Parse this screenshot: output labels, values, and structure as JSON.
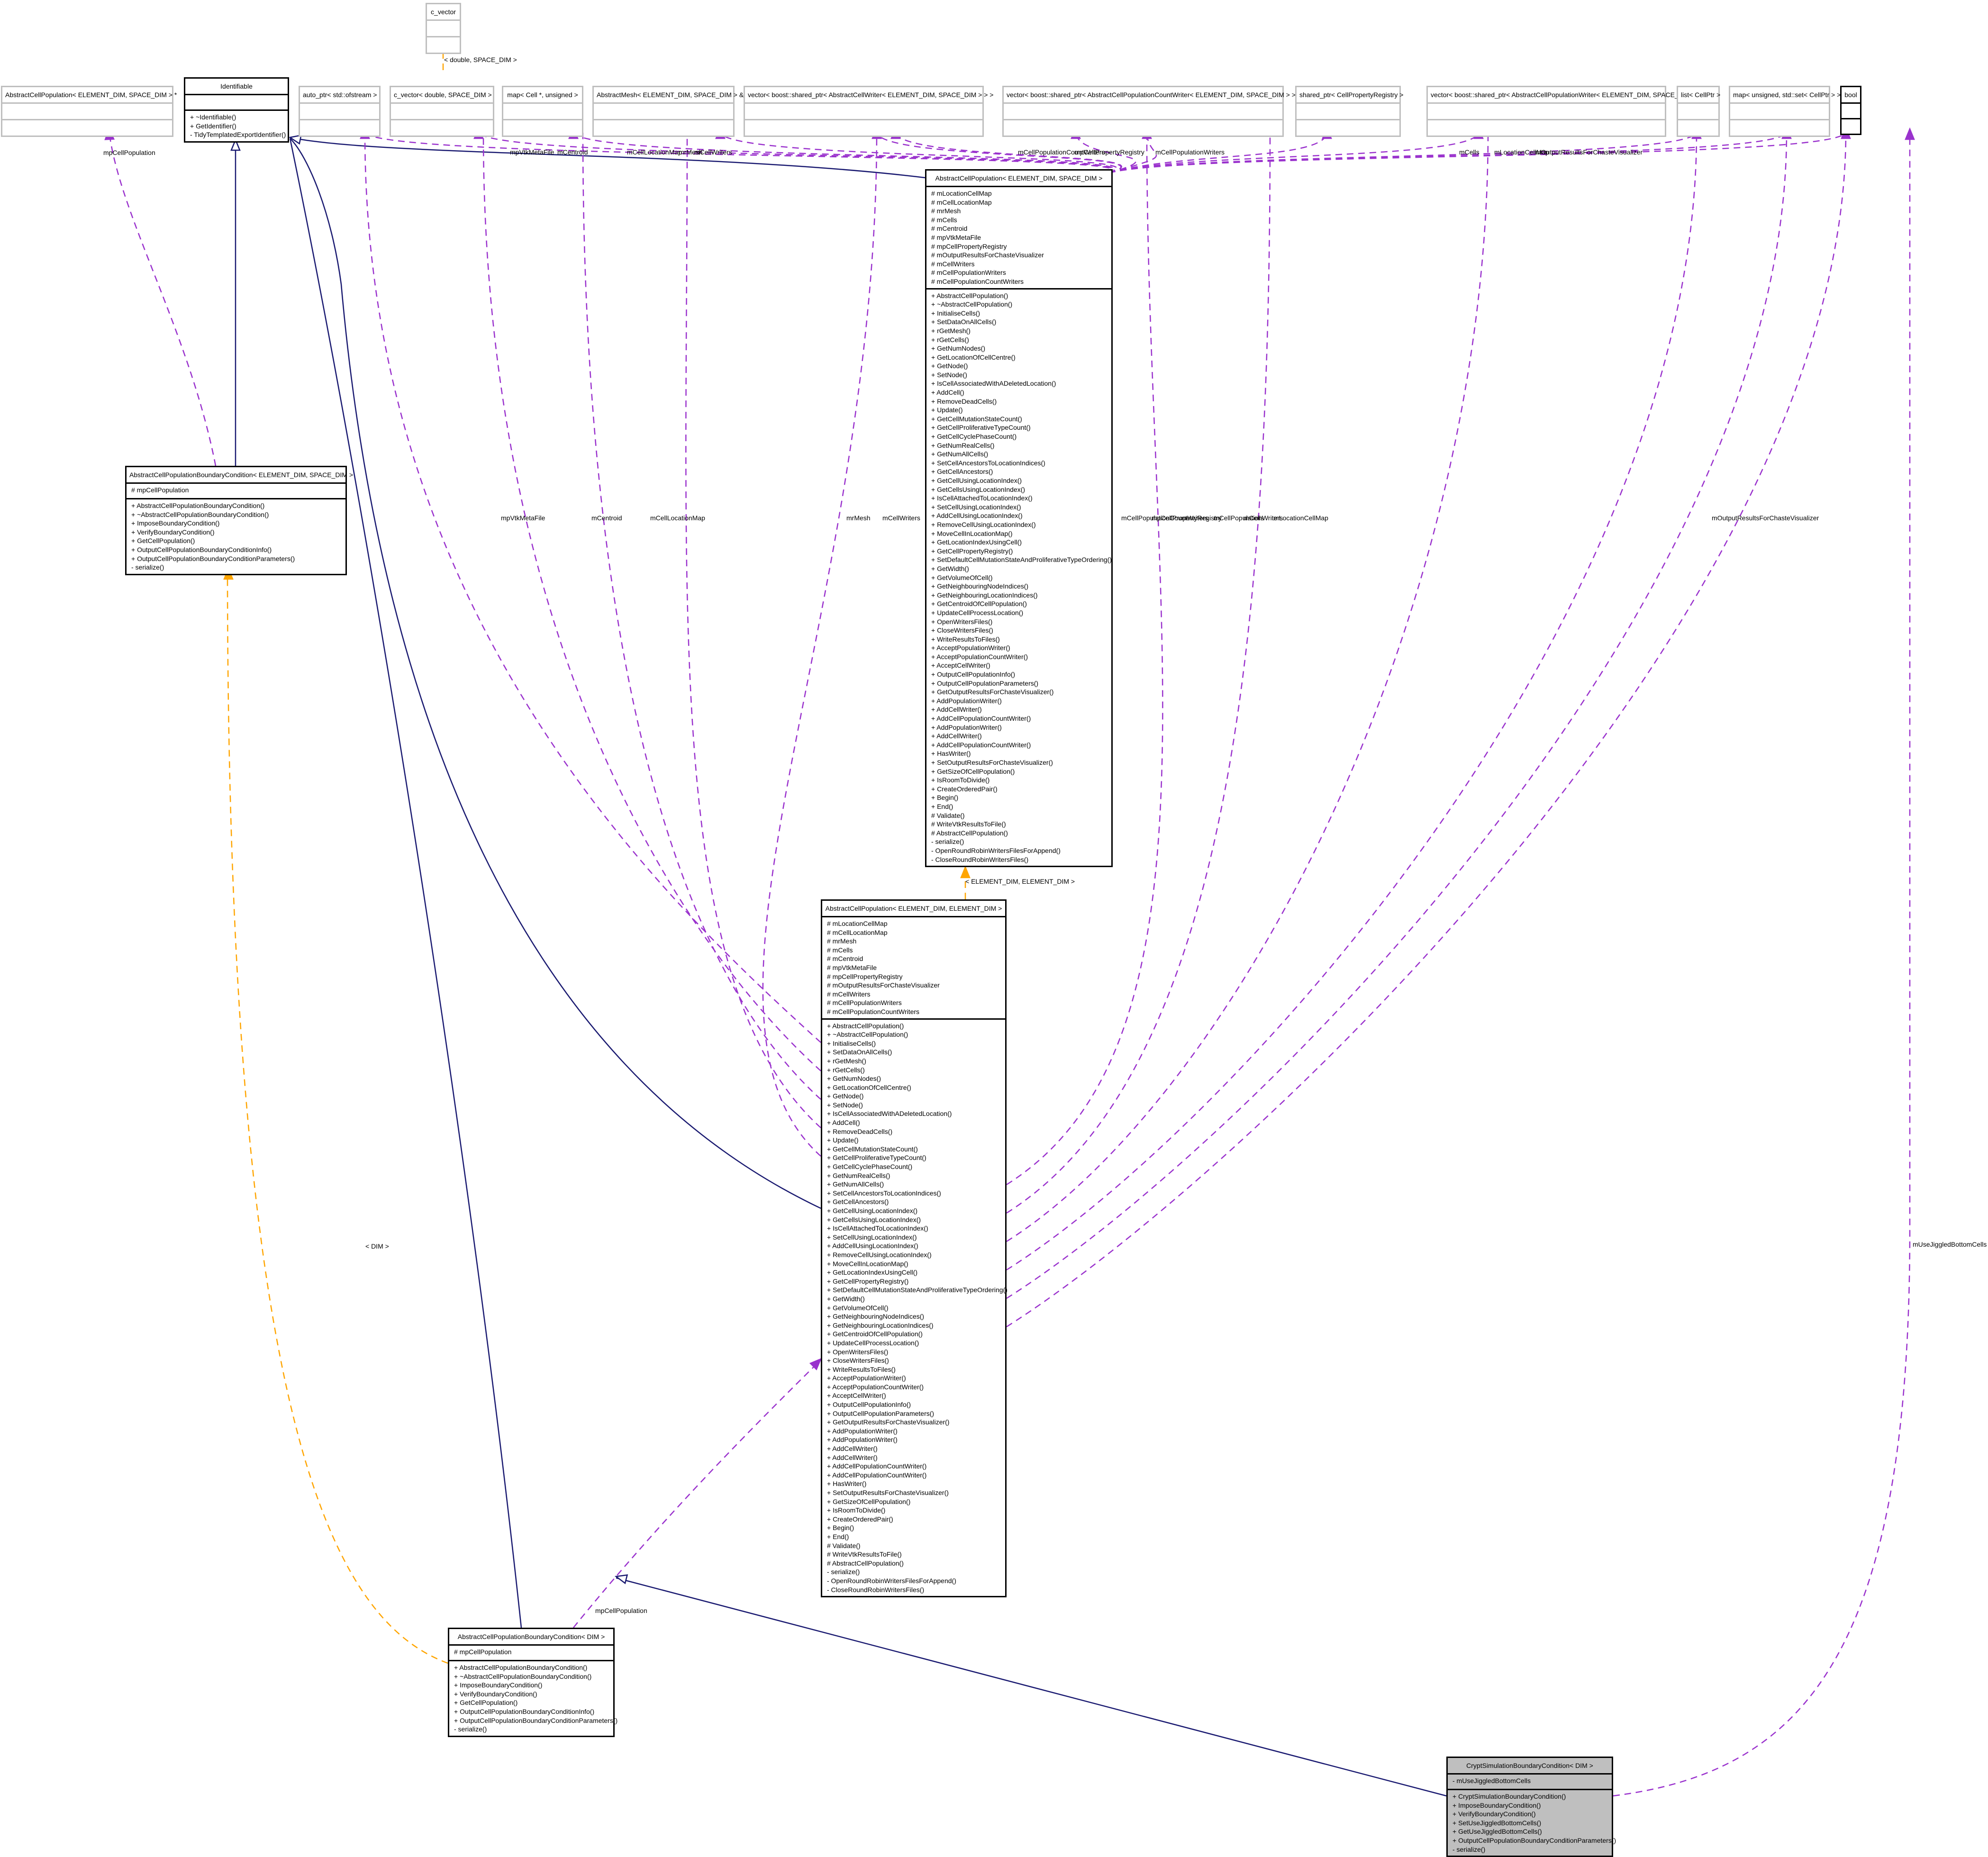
{
  "colors": {
    "inheritance": "#191970",
    "usage": "#9a32cd",
    "template": "#ffa500",
    "highlight_fill": "#bfbfbf",
    "placeholder_border": "#bfbfbf"
  },
  "nodes": {
    "c_vector": {
      "title": "c_vector",
      "attributes": [],
      "methods": []
    },
    "acp_ptr": {
      "title": "AbstractCellPopulation< ELEMENT_DIM, SPACE_DIM > *",
      "attributes": [],
      "methods": []
    },
    "identifiable": {
      "title": "Identifiable",
      "attributes": [],
      "methods": [
        "+ ~Identifiable()",
        "+ GetIdentifier()",
        "- TidyTemplatedExportIdentifier()"
      ]
    },
    "auto_ptr": {
      "title": "auto_ptr< std::ofstream >",
      "attributes": [],
      "methods": []
    },
    "c_vector_double": {
      "title": "c_vector< double, SPACE_DIM >",
      "attributes": [],
      "methods": []
    },
    "map_cell_unsigned": {
      "title": "map< Cell *, unsigned >",
      "attributes": [],
      "methods": []
    },
    "abstract_mesh": {
      "title": "AbstractMesh< ELEMENT_DIM, SPACE_DIM > &",
      "attributes": [],
      "methods": []
    },
    "vec_cell_writer": {
      "title": "vector< boost::shared_ptr< AbstractCellWriter< ELEMENT_DIM, SPACE_DIM > > >",
      "attributes": [],
      "methods": []
    },
    "vec_count_writer": {
      "title": "vector< boost::shared_ptr< AbstractCellPopulationCountWriter< ELEMENT_DIM, SPACE_DIM > > >",
      "attributes": [],
      "methods": []
    },
    "shared_registry": {
      "title": "shared_ptr< CellPropertyRegistry >",
      "attributes": [],
      "methods": []
    },
    "vec_pop_writer": {
      "title": "vector< boost::shared_ptr< AbstractCellPopulationWriter< ELEMENT_DIM, SPACE_DIM > > >",
      "attributes": [],
      "methods": []
    },
    "list_cellptr": {
      "title": "list< CellPtr >",
      "attributes": [],
      "methods": []
    },
    "map_unsigned_set": {
      "title": "map< unsigned, std::set< CellPtr > >",
      "attributes": [],
      "methods": []
    },
    "bool": {
      "title": "bool",
      "attributes": [],
      "methods": []
    },
    "acp_es": {
      "title": "AbstractCellPopulation< ELEMENT_DIM, SPACE_DIM >",
      "attributes": [
        "# mLocationCellMap",
        "# mCellLocationMap",
        "# mrMesh",
        "# mCells",
        "# mCentroid",
        "# mpVtkMetaFile",
        "# mpCellPropertyRegistry",
        "# mOutputResultsForChasteVisualizer",
        "# mCellWriters",
        "# mCellPopulationWriters",
        "# mCellPopulationCountWriters"
      ],
      "methods": [
        "+ AbstractCellPopulation()",
        "+ ~AbstractCellPopulation()",
        "+ InitialiseCells()",
        "+ SetDataOnAllCells()",
        "+ rGetMesh()",
        "+ rGetCells()",
        "+ GetNumNodes()",
        "+ GetLocationOfCellCentre()",
        "+ GetNode()",
        "+ SetNode()",
        "+ IsCellAssociatedWithADeletedLocation()",
        "+ AddCell()",
        "+ RemoveDeadCells()",
        "+ Update()",
        "+ GetCellMutationStateCount()",
        "+ GetCellProliferativeTypeCount()",
        "+ GetCellCyclePhaseCount()",
        "+ GetNumRealCells()",
        "+ GetNumAllCells()",
        "+ SetCellAncestorsToLocationIndices()",
        "+ GetCellAncestors()",
        "+ GetCellUsingLocationIndex()",
        "+ GetCellsUsingLocationIndex()",
        "+ IsCellAttachedToLocationIndex()",
        "+ SetCellUsingLocationIndex()",
        "+ AddCellUsingLocationIndex()",
        "+ RemoveCellUsingLocationIndex()",
        "+ MoveCellInLocationMap()",
        "+ GetLocationIndexUsingCell()",
        "+ GetCellPropertyRegistry()",
        "+ SetDefaultCellMutationStateAndProliferativeTypeOrdering()",
        "+ GetWidth()",
        "+ GetVolumeOfCell()",
        "+ GetNeighbouringNodeIndices()",
        "+ GetNeighbouringLocationIndices()",
        "+ GetCentroidOfCellPopulation()",
        "+ UpdateCellProcessLocation()",
        "+ OpenWritersFiles()",
        "+ CloseWritersFiles()",
        "+ WriteResultsToFiles()",
        "+ AcceptPopulationWriter()",
        "+ AcceptPopulationCountWriter()",
        "+ AcceptCellWriter()",
        "+ OutputCellPopulationInfo()",
        "+ OutputCellPopulationParameters()",
        "+ GetOutputResultsForChasteVisualizer()",
        "+ AddPopulationWriter()",
        "+ AddCellWriter()",
        "+ AddCellPopulationCountWriter()",
        "+ AddPopulationWriter()",
        "+ AddCellWriter()",
        "+ AddCellPopulationCountWriter()",
        "+ HasWriter()",
        "+ SetOutputResultsForChasteVisualizer()",
        "+ GetSizeOfCellPopulation()",
        "+ IsRoomToDivide()",
        "+ CreateOrderedPair()",
        "+ Begin()",
        "+ End()",
        "# Validate()",
        "# WriteVtkResultsToFile()",
        "# AbstractCellPopulation()",
        "- serialize()",
        "- OpenRoundRobinWritersFilesForAppend()",
        "- CloseRoundRobinWritersFiles()"
      ]
    },
    "acpbc_es": {
      "title": "AbstractCellPopulationBoundaryCondition< ELEMENT_DIM, SPACE_DIM >",
      "attributes": [
        "# mpCellPopulation"
      ],
      "methods": [
        "+ AbstractCellPopulationBoundaryCondition()",
        "+ ~AbstractCellPopulationBoundaryCondition()",
        "+ ImposeBoundaryCondition()",
        "+ VerifyBoundaryCondition()",
        "+ GetCellPopulation()",
        "+ OutputCellPopulationBoundaryConditionInfo()",
        "+ OutputCellPopulationBoundaryConditionParameters()",
        "- serialize()"
      ]
    },
    "acp_ee": {
      "title": "AbstractCellPopulation< ELEMENT_DIM, ELEMENT_DIM >",
      "attributes": [
        "# mLocationCellMap",
        "# mCellLocationMap",
        "# mrMesh",
        "# mCells",
        "# mCentroid",
        "# mpVtkMetaFile",
        "# mpCellPropertyRegistry",
        "# mOutputResultsForChasteVisualizer",
        "# mCellWriters",
        "# mCellPopulationWriters",
        "# mCellPopulationCountWriters"
      ],
      "methods": [
        "+ AbstractCellPopulation()",
        "+ ~AbstractCellPopulation()",
        "+ InitialiseCells()",
        "+ SetDataOnAllCells()",
        "+ rGetMesh()",
        "+ rGetCells()",
        "+ GetNumNodes()",
        "+ GetLocationOfCellCentre()",
        "+ GetNode()",
        "+ SetNode()",
        "+ IsCellAssociatedWithADeletedLocation()",
        "+ AddCell()",
        "+ RemoveDeadCells()",
        "+ Update()",
        "+ GetCellMutationStateCount()",
        "+ GetCellProliferativeTypeCount()",
        "+ GetCellCyclePhaseCount()",
        "+ GetNumRealCells()",
        "+ GetNumAllCells()",
        "+ SetCellAncestorsToLocationIndices()",
        "+ GetCellAncestors()",
        "+ GetCellUsingLocationIndex()",
        "+ GetCellsUsingLocationIndex()",
        "+ IsCellAttachedToLocationIndex()",
        "+ SetCellUsingLocationIndex()",
        "+ AddCellUsingLocationIndex()",
        "+ RemoveCellUsingLocationIndex()",
        "+ MoveCellInLocationMap()",
        "+ GetLocationIndexUsingCell()",
        "+ GetCellPropertyRegistry()",
        "+ SetDefaultCellMutationStateAndProliferativeTypeOrdering()",
        "+ GetWidth()",
        "+ GetVolumeOfCell()",
        "+ GetNeighbouringNodeIndices()",
        "+ GetNeighbouringLocationIndices()",
        "+ GetCentroidOfCellPopulation()",
        "+ UpdateCellProcessLocation()",
        "+ OpenWritersFiles()",
        "+ CloseWritersFiles()",
        "+ WriteResultsToFiles()",
        "+ AcceptPopulationWriter()",
        "+ AcceptPopulationCountWriter()",
        "+ AcceptCellWriter()",
        "+ OutputCellPopulationInfo()",
        "+ OutputCellPopulationParameters()",
        "+ GetOutputResultsForChasteVisualizer()",
        "+ AddPopulationWriter()",
        "+ AddPopulationWriter()",
        "+ AddCellWriter()",
        "+ AddCellWriter()",
        "+ AddCellPopulationCountWriter()",
        "+ AddCellPopulationCountWriter()",
        "+ HasWriter()",
        "+ SetOutputResultsForChasteVisualizer()",
        "+ GetSizeOfCellPopulation()",
        "+ IsRoomToDivide()",
        "+ CreateOrderedPair()",
        "+ Begin()",
        "+ End()",
        "# Validate()",
        "# WriteVtkResultsToFile()",
        "# AbstractCellPopulation()",
        "- serialize()",
        "- OpenRoundRobinWritersFilesForAppend()",
        "- CloseRoundRobinWritersFiles()"
      ]
    },
    "acpbc_dim": {
      "title": "AbstractCellPopulationBoundaryCondition< DIM >",
      "attributes": [
        "# mpCellPopulation"
      ],
      "methods": [
        "+ AbstractCellPopulationBoundaryCondition()",
        "+ ~AbstractCellPopulationBoundaryCondition()",
        "+ ImposeBoundaryCondition()",
        "+ VerifyBoundaryCondition()",
        "+ GetCellPopulation()",
        "+ OutputCellPopulationBoundaryConditionInfo()",
        "+ OutputCellPopulationBoundaryConditionParameters()",
        "- serialize()"
      ]
    },
    "crypt_bc": {
      "title": "CryptSimulationBoundaryCondition< DIM >",
      "attributes": [
        "- mUseJiggledBottomCells"
      ],
      "methods": [
        "+ CryptSimulationBoundaryCondition()",
        "+ ImposeBoundaryCondition()",
        "+ VerifyBoundaryCondition()",
        "+ SetUseJiggledBottomCells()",
        "+ GetUseJiggledBottomCells()",
        "+ OutputCellPopulationBoundaryConditionParameters()",
        "- serialize()"
      ]
    }
  },
  "edge_labels": {
    "c_vector_tmpl": "< double, SPACE_DIM >",
    "ee_tmpl": "< ELEMENT_DIM, ELEMENT_DIM >",
    "dim_tmpl": "< DIM >",
    "top_mpCellPopulation": "mpCellPopulation",
    "top_mpVtkMetaFile": "mpVtkMetaFile",
    "top_mCentroid": "mCentroid",
    "top_mCellLocationMap": "mCellLocationMap",
    "top_mrMesh": "mrMesh",
    "top_mCellWriters": "mCellWriters",
    "top_mCellPopulationCountWriters": "mCellPopulationCountWriters",
    "top_mpCellPropertyRegistry": "mpCellPropertyRegistry",
    "top_mCellPopulationWriters": "mCellPopulationWriters",
    "top_mCells": "mCells",
    "top_mLocationCellMap": "mLocationCellMap",
    "top_mOutputResultsForChasteVisualizer": "mOutputResultsForChasteVisualizer",
    "mid_mpVtkMetaFile": "mpVtkMetaFile",
    "mid_mCentroid": "mCentroid",
    "mid_mCellLocationMap": "mCellLocationMap",
    "mid_mrMesh": "mrMesh",
    "mid_mCellWriters": "mCellWriters",
    "mid_mCellPopulationCountWriters": "mCellPopulationCountWriters",
    "mid_mpCellPropertyRegistry": "mpCellPropertyRegistry",
    "mid_mCellPopulationWriters": "mCellPopulationWriters",
    "mid_mCells": "mCells",
    "mid_mLocationCellMap": "mLocationCellMap",
    "mid_mOutputResultsForChasteVisualizer": "mOutputResultsForChasteVisualizer",
    "bottom_mpCellPopulation": "mpCellPopulation",
    "mUseJiggledBottomCells": "mUseJiggledBottomCells"
  }
}
